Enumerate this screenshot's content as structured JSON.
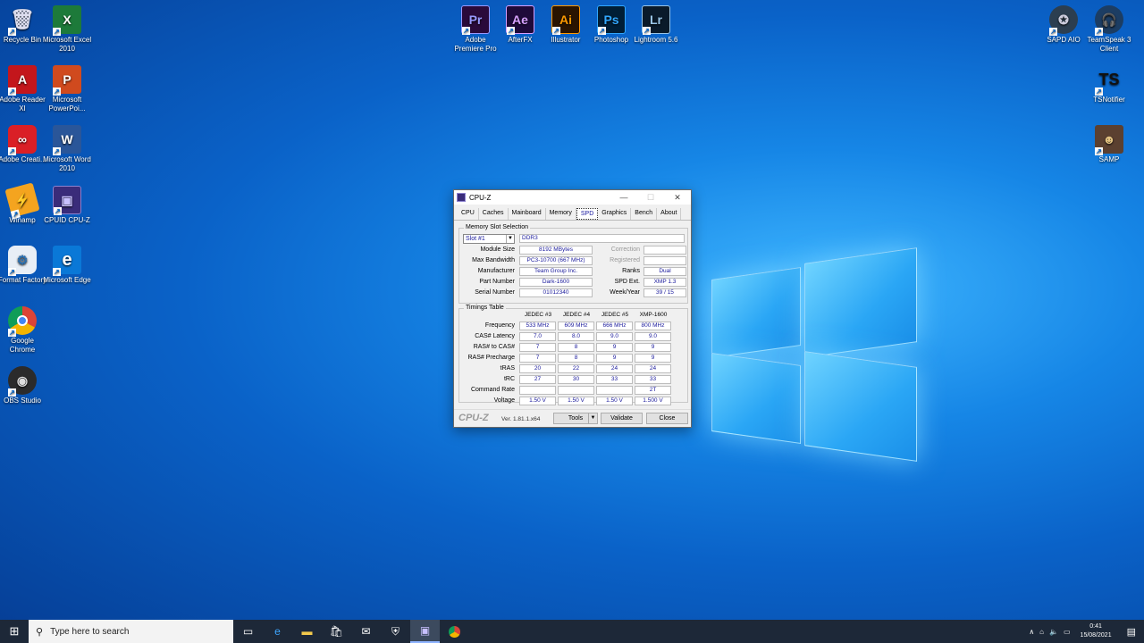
{
  "desktop": {
    "left_icons": [
      {
        "label": "Recycle Bin",
        "icon": "recycle-bin-icon"
      },
      {
        "label": "Microsoft Excel 2010",
        "icon": "excel-icon"
      },
      {
        "label": "Adobe Reader XI",
        "icon": "adobe-reader-icon"
      },
      {
        "label": "Microsoft PowerPoi...",
        "icon": "powerpoint-icon"
      },
      {
        "label": "Adobe Creati...",
        "icon": "creative-cloud-icon"
      },
      {
        "label": "Microsoft Word 2010",
        "icon": "word-icon"
      },
      {
        "label": "Winamp",
        "icon": "winamp-icon"
      },
      {
        "label": "CPUID CPU-Z",
        "icon": "cpuz-icon"
      },
      {
        "label": "Format Factory",
        "icon": "format-factory-icon"
      },
      {
        "label": "Microsoft Edge",
        "icon": "edge-icon"
      },
      {
        "label": "Google Chrome",
        "icon": "chrome-icon"
      },
      {
        "label": "OBS Studio",
        "icon": "obs-icon"
      }
    ],
    "top_icons": [
      {
        "label": "Adobe Premiere Pro",
        "abbr": "Pr",
        "color": "#9999ff",
        "bg": "#2a0a3a"
      },
      {
        "label": "AfterFX",
        "abbr": "Ae",
        "color": "#d6a0ff",
        "bg": "#1f0a3a"
      },
      {
        "label": "Illustrator",
        "abbr": "Ai",
        "color": "#ff9a00",
        "bg": "#2a1400"
      },
      {
        "label": "Photoshop",
        "abbr": "Ps",
        "color": "#31a8ff",
        "bg": "#001e36"
      },
      {
        "label": "Lightroom 5.6",
        "abbr": "Lr",
        "color": "#9ac6e8",
        "bg": "#0a1a2a"
      }
    ],
    "right_icons": [
      {
        "label": "SAPD AIO",
        "icon": "sapd-icon"
      },
      {
        "label": "TeamSpeak 3 Client",
        "icon": "teamspeak-icon"
      },
      {
        "label": "TSNotifier",
        "abbr": "TS",
        "icon": "tsnotifier-icon"
      },
      {
        "label": "SAMP",
        "icon": "samp-icon"
      }
    ]
  },
  "cpuz": {
    "title": "CPU-Z",
    "tabs": [
      "CPU",
      "Caches",
      "Mainboard",
      "Memory",
      "SPD",
      "Graphics",
      "Bench",
      "About"
    ],
    "active_tab": "SPD",
    "slot_group": "Memory Slot Selection",
    "slot_value": "Slot #1",
    "mem_type": "DDR3",
    "left_fields": [
      {
        "label": "Module Size",
        "value": "8192 MBytes"
      },
      {
        "label": "Max Bandwidth",
        "value": "PC3-10700 (667 MHz)"
      },
      {
        "label": "Manufacturer",
        "value": "Team Group Inc."
      },
      {
        "label": "Part Number",
        "value": "Dark-1600"
      },
      {
        "label": "Serial Number",
        "value": "01012340"
      }
    ],
    "right_fields": [
      {
        "label": "Correction",
        "value": ""
      },
      {
        "label": "Registered",
        "value": ""
      },
      {
        "label": "Ranks",
        "value": "Dual"
      },
      {
        "label": "SPD Ext.",
        "value": "XMP 1.3"
      },
      {
        "label": "Week/Year",
        "value": "39 / 15"
      }
    ],
    "timings_group": "Timings Table",
    "timing_headers": [
      "JEDEC #3",
      "JEDEC #4",
      "JEDEC #5",
      "XMP-1600"
    ],
    "timing_rows": [
      {
        "label": "Frequency",
        "values": [
          "533 MHz",
          "609 MHz",
          "666 MHz",
          "800 MHz"
        ]
      },
      {
        "label": "CAS# Latency",
        "values": [
          "7.0",
          "8.0",
          "9.0",
          "9.0"
        ]
      },
      {
        "label": "RAS# to CAS#",
        "values": [
          "7",
          "8",
          "9",
          "9"
        ]
      },
      {
        "label": "RAS# Precharge",
        "values": [
          "7",
          "8",
          "9",
          "9"
        ]
      },
      {
        "label": "tRAS",
        "values": [
          "20",
          "22",
          "24",
          "24"
        ]
      },
      {
        "label": "tRC",
        "values": [
          "27",
          "30",
          "33",
          "33"
        ]
      },
      {
        "label": "Command Rate",
        "values": [
          "",
          "",
          "",
          "2T"
        ]
      },
      {
        "label": "Voltage",
        "values": [
          "1.50 V",
          "1.50 V",
          "1.50 V",
          "1.500 V"
        ]
      }
    ],
    "brand": "CPU-Z",
    "version": "Ver. 1.81.1.x64",
    "tools_label": "Tools",
    "validate_label": "Validate",
    "close_label": "Close"
  },
  "taskbar": {
    "search_placeholder": "Type here to search",
    "time": "0:41",
    "date": "15/08/2021"
  }
}
